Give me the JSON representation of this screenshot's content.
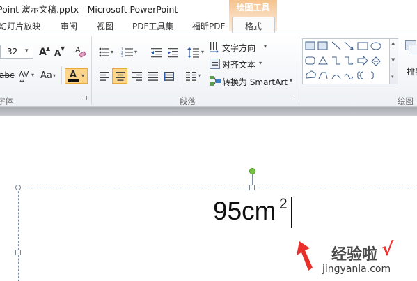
{
  "titlebar": {
    "title": "Point 演示文稿.pptx  -  Microsoft PowerPoint",
    "context_group_label": "绘图工具"
  },
  "tabs": [
    {
      "label": "幻灯片放映"
    },
    {
      "label": "审阅"
    },
    {
      "label": "视图"
    },
    {
      "label": "PDF工具集"
    },
    {
      "label": "福昕PDF"
    },
    {
      "label": "格式"
    }
  ],
  "ribbon": {
    "font": {
      "size_value": "32",
      "group_label": "字体",
      "grow_glyph": "A",
      "shrink_glyph": "A",
      "clear_format_glyph": "A",
      "strike_glyph": "abc",
      "spacing_glyph": "AV",
      "case_glyph": "Aa",
      "font_color_glyph": "A"
    },
    "paragraph": {
      "group_label": "段落",
      "text_direction_label": "文字方向",
      "align_text_label": "对齐文本",
      "smartart_label": "转换为 SmartArt"
    },
    "drawing": {
      "group_label": "绘图",
      "arrange_label": "排列"
    }
  },
  "slide": {
    "text_main": "95cm",
    "text_superscript": "2"
  },
  "watermark": {
    "text_cn": "经验啦",
    "text_url": "jingyanla.com",
    "check": "√"
  },
  "colors": {
    "context_tab": "#f7c894",
    "selected_button": "#fcd58a",
    "annotation_arrow": "#e8302a",
    "rotation_handle": "#76c043"
  }
}
